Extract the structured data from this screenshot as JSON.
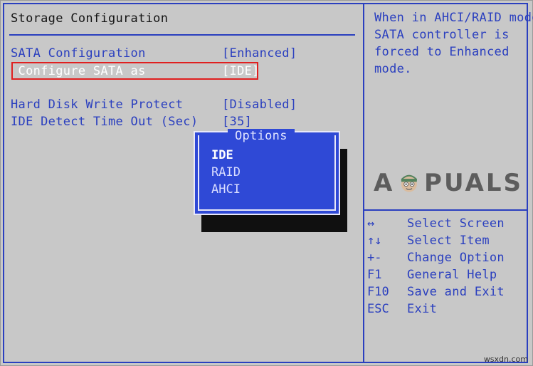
{
  "section_title": "Storage Configuration",
  "settings": [
    {
      "label": "SATA Configuration",
      "value": "[Enhanced]"
    },
    {
      "label": " Configure SATA as",
      "value": "[IDE]"
    },
    {
      "label": "Hard Disk Write Protect",
      "value": "[Disabled]"
    },
    {
      "label": "IDE Detect Time Out (Sec)",
      "value": "[35]"
    }
  ],
  "help_text": [
    "When in AHCI/RAID mode",
    "SATA controller is",
    "forced to Enhanced",
    "mode."
  ],
  "options_popup": {
    "title": "Options",
    "options": [
      "IDE",
      "RAID",
      "AHCI"
    ],
    "selected": "IDE"
  },
  "key_legend": [
    {
      "key": "↔",
      "desc": "Select Screen"
    },
    {
      "key": "↑↓",
      "desc": "Select Item"
    },
    {
      "key": "+-",
      "desc": "Change Option"
    },
    {
      "key": "F1",
      "desc": "General Help"
    },
    {
      "key": "F10",
      "desc": "Save and Exit"
    },
    {
      "key": "ESC",
      "desc": "Exit"
    }
  ],
  "watermark": {
    "prefix": "A",
    "suffix": "PUALS"
  },
  "credit": "wsxdn.com",
  "colors": {
    "background": "#c8c8c8",
    "bios_blue": "#2a3fbf",
    "popup_blue": "#2f49d6",
    "highlight_red": "#e02020"
  }
}
